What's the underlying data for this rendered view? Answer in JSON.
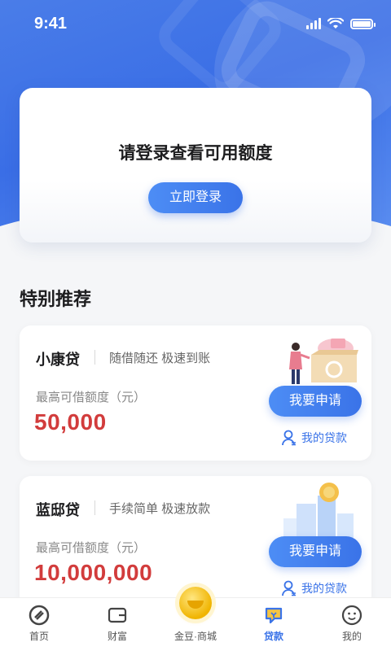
{
  "status_bar": {
    "time": "9:41"
  },
  "login_card": {
    "title": "请登录查看可用额度",
    "button": "立即登录"
  },
  "section": {
    "title": "特别推荐"
  },
  "loans": [
    {
      "name": "小康贷",
      "tag": "随借随还  极速到账",
      "label": "最高可借额度（元）",
      "amount": "50,000",
      "apply": "我要申请",
      "my_loan": "我的贷款"
    },
    {
      "name": "蓝邸贷",
      "tag": "手续简单  极速放款",
      "label": "最高可借额度（元）",
      "amount": "10,000,000",
      "apply": "我要申请",
      "my_loan": "我的贷款"
    }
  ],
  "tabbar": {
    "items": [
      {
        "label": "首页",
        "icon": "home-logo-icon"
      },
      {
        "label": "财富",
        "icon": "wallet-icon"
      },
      {
        "label": "金豆·商城",
        "icon": "gold-bean-icon"
      },
      {
        "label": "贷款",
        "icon": "loan-icon"
      },
      {
        "label": "我的",
        "icon": "profile-face-icon"
      }
    ],
    "active": "贷款"
  },
  "colors": {
    "primary": "#3a73e8",
    "amount_red": "#d23c3c",
    "hero_blue": "#4a7de8",
    "gold": "#f0b400"
  }
}
